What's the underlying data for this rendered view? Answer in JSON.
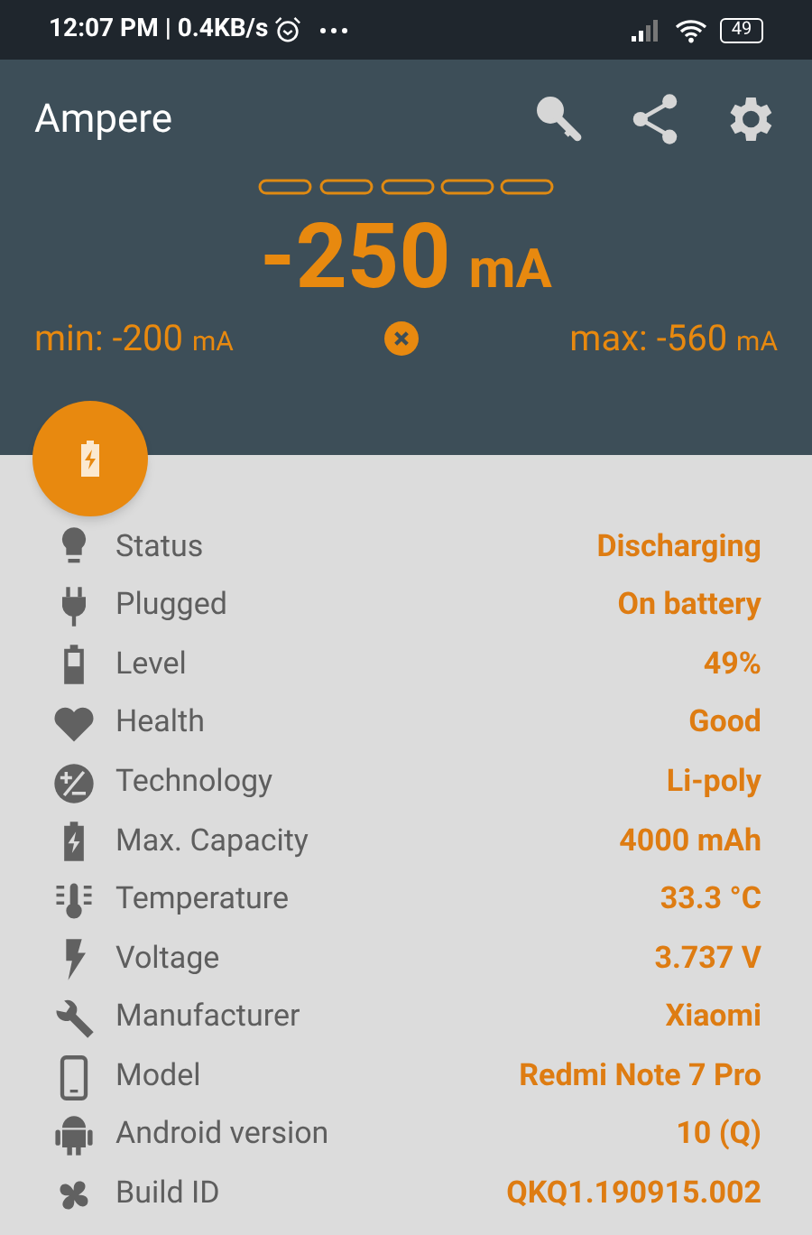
{
  "status_bar": {
    "time": "12:07 PM | 0.4KB/s",
    "battery": "49"
  },
  "app_bar": {
    "title": "Ampere"
  },
  "current": {
    "value": "-250",
    "unit": "mA",
    "min_label": "min: -200",
    "min_unit": "mA",
    "max_label": "max: -560",
    "max_unit": "mA"
  },
  "details": [
    {
      "label": "Status",
      "value": "Discharging"
    },
    {
      "label": "Plugged",
      "value": "On battery"
    },
    {
      "label": "Level",
      "value": "49%"
    },
    {
      "label": "Health",
      "value": "Good"
    },
    {
      "label": "Technology",
      "value": "Li-poly"
    },
    {
      "label": "Max. Capacity",
      "value": "4000 mAh"
    },
    {
      "label": "Temperature",
      "value": "33.3 °C"
    },
    {
      "label": "Voltage",
      "value": "3.737 V"
    },
    {
      "label": "Manufacturer",
      "value": "Xiaomi"
    },
    {
      "label": "Model",
      "value": "Redmi Note 7 Pro"
    },
    {
      "label": "Android version",
      "value": "10 (Q)"
    },
    {
      "label": "Build ID",
      "value": "QKQ1.190915.002"
    }
  ]
}
